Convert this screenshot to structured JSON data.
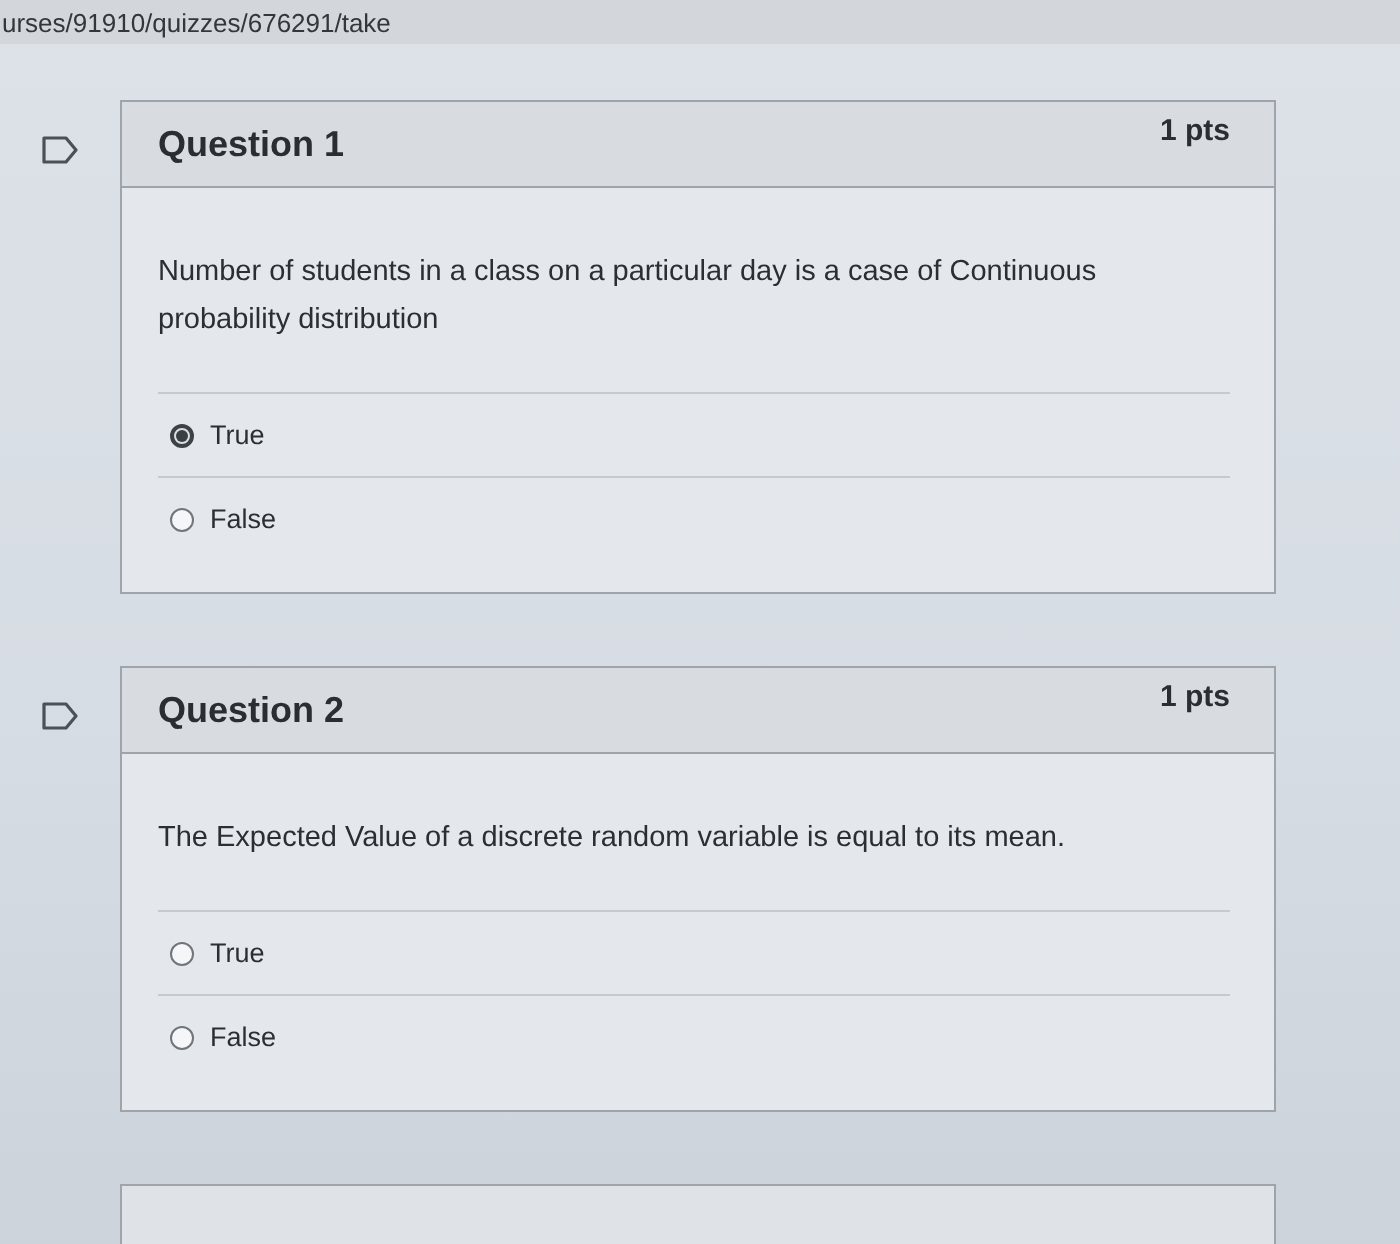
{
  "address_bar": {
    "url": "urses/91910/quizzes/676291/take"
  },
  "questions": [
    {
      "title": "Question 1",
      "points": "1 pts",
      "text": "Number of students in a class on a particular day is a case of Continuous probability distribution",
      "answers": [
        {
          "label": "True",
          "selected": true
        },
        {
          "label": "False",
          "selected": false
        }
      ]
    },
    {
      "title": "Question 2",
      "points": "1 pts",
      "text": "The Expected Value of a discrete random variable is equal to its mean.",
      "answers": [
        {
          "label": "True",
          "selected": false
        },
        {
          "label": "False",
          "selected": false
        }
      ]
    }
  ]
}
